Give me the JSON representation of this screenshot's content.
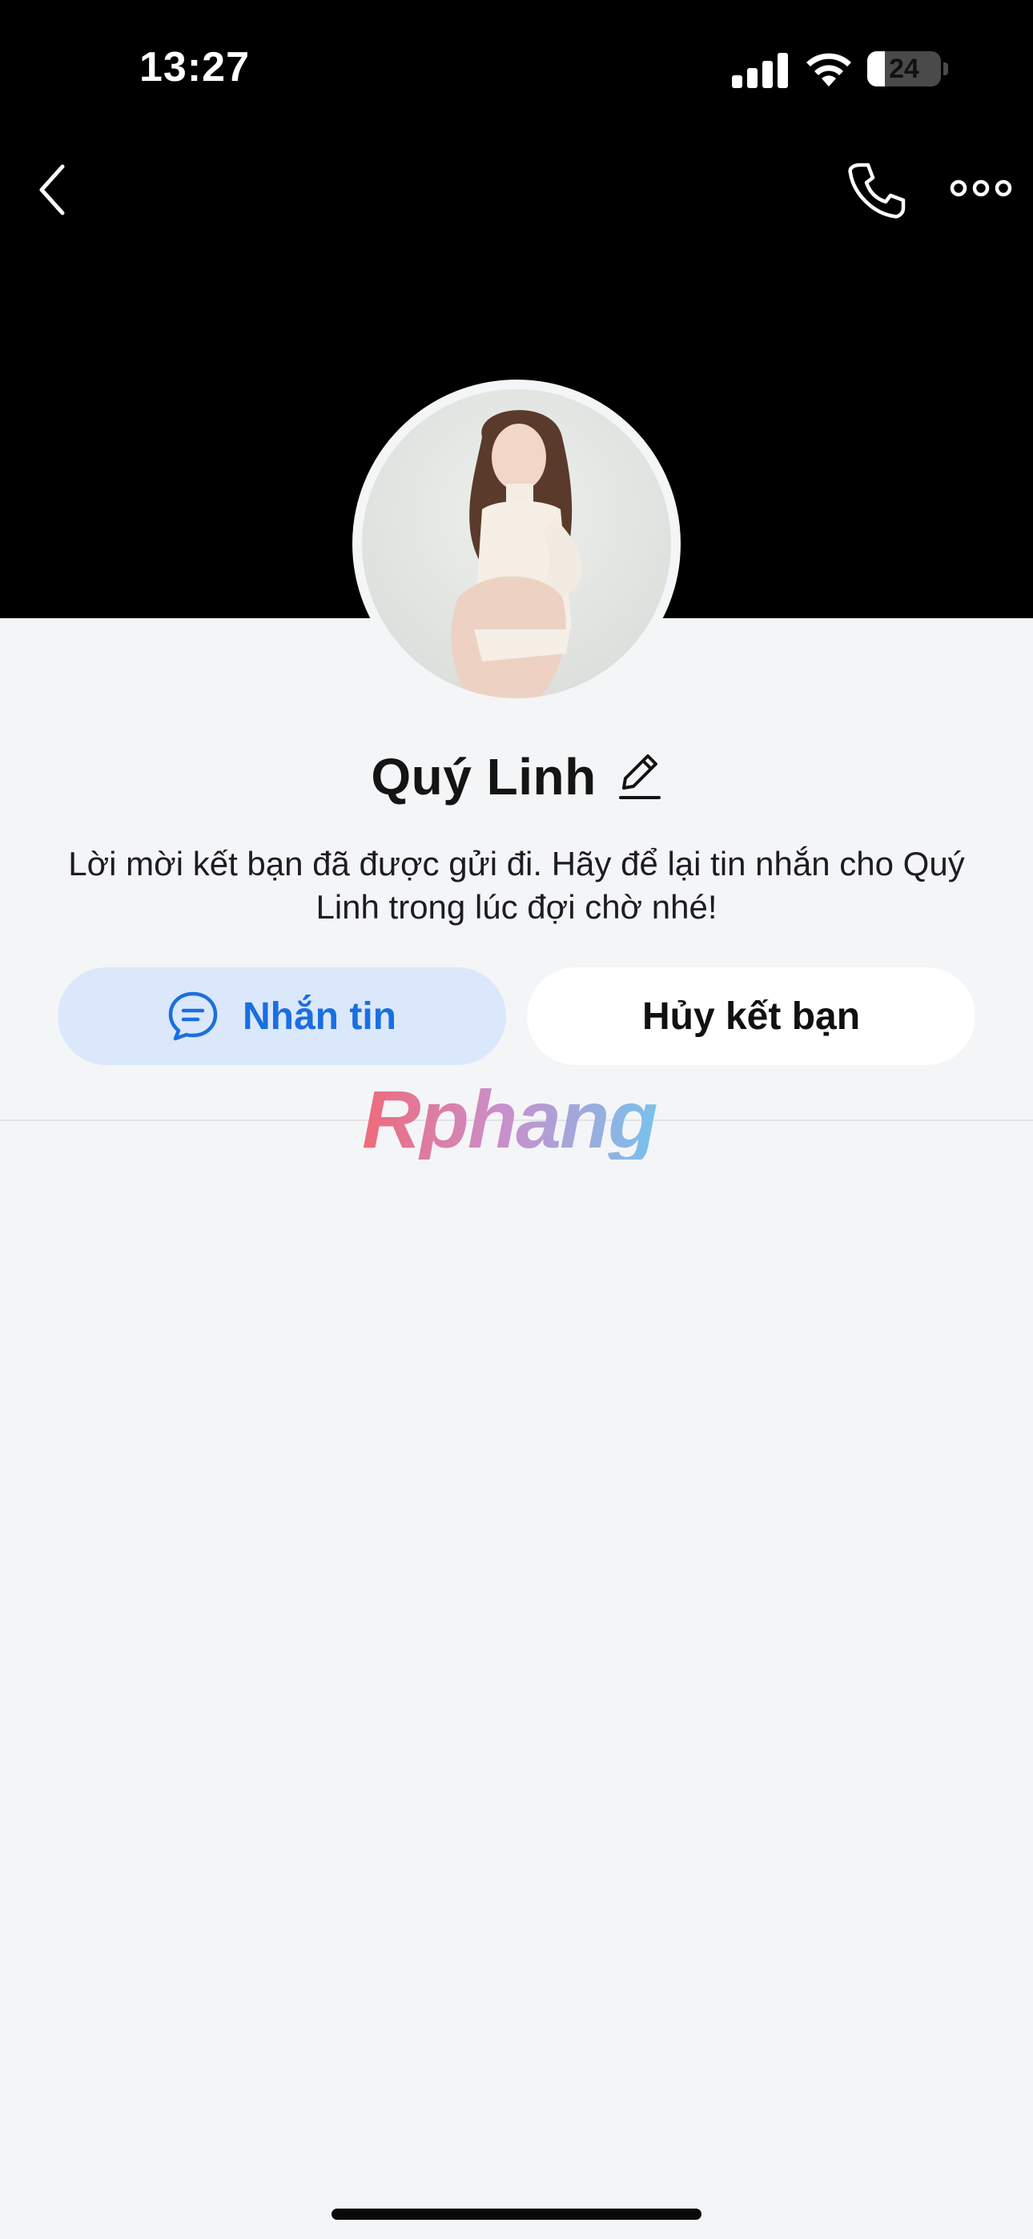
{
  "status_bar": {
    "time": "13:27",
    "battery_level": "24",
    "battery_percent": 24,
    "signal_bars": 4,
    "icons": [
      "cellular-signal-icon",
      "wifi-icon",
      "battery-icon"
    ]
  },
  "header": {
    "icons": [
      "back-icon",
      "phone-call-icon",
      "more-options-icon"
    ]
  },
  "profile": {
    "name": "Quý Linh",
    "edit_icon": "pencil-icon",
    "friend_request_note": "Lời mời kết bạn đã được gửi đi. Hãy để lại tin nhắn cho Quý Linh trong lúc đợi chờ nhé!"
  },
  "actions": {
    "message_label": "Nhắn tin",
    "message_icon": "chat-bubble-icon",
    "cancel_friend_label": "Hủy kết bạn"
  },
  "watermark": {
    "text": "Rphang"
  },
  "colors": {
    "cover": "#000000",
    "background": "#f4f5f7",
    "accent_blue": "#1a6fe0",
    "message_button_bg": "#dbe8fb",
    "unfriend_button_bg": "#ffffff"
  }
}
